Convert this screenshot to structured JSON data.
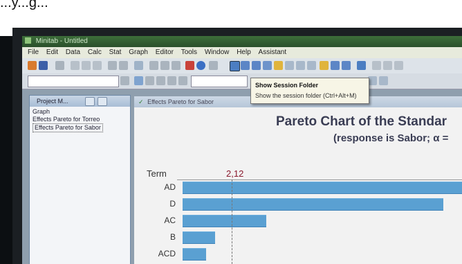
{
  "caption": {
    "text": "...y...g..."
  },
  "window": {
    "title": "Minitab - Untitled"
  },
  "menu": {
    "items": [
      "File",
      "Edit",
      "Data",
      "Calc",
      "Stat",
      "Graph",
      "Editor",
      "Tools",
      "Window",
      "Help",
      "Assistant"
    ]
  },
  "tooltip": {
    "title": "Show Session Folder",
    "description": "Show the session folder (Ctrl+Alt+M)"
  },
  "project_manager": {
    "title": "Project M...",
    "items": [
      "Graph",
      "Effects Pareto for Torreo",
      "Effects Pareto for Sabor"
    ],
    "selected_index": 2
  },
  "graph_window": {
    "title": "Effects Pareto for Sabor"
  },
  "chart_data": {
    "type": "bar",
    "title": "Pareto Chart of the Standar",
    "subtitle": "(response is Sabor; α =",
    "ylabel": "Term",
    "reference_value": 2.12,
    "reference_label": "2,12",
    "categories": [
      "AD",
      "D",
      "AC",
      "B",
      "ACD"
    ],
    "values": [
      12.0,
      11.2,
      3.6,
      1.4,
      1.0
    ],
    "xlim": [
      0,
      12.0
    ]
  },
  "colors": {
    "bar": "#5aa0d2",
    "reference_line": "#777777",
    "critical_label": "#8a1a2e"
  }
}
